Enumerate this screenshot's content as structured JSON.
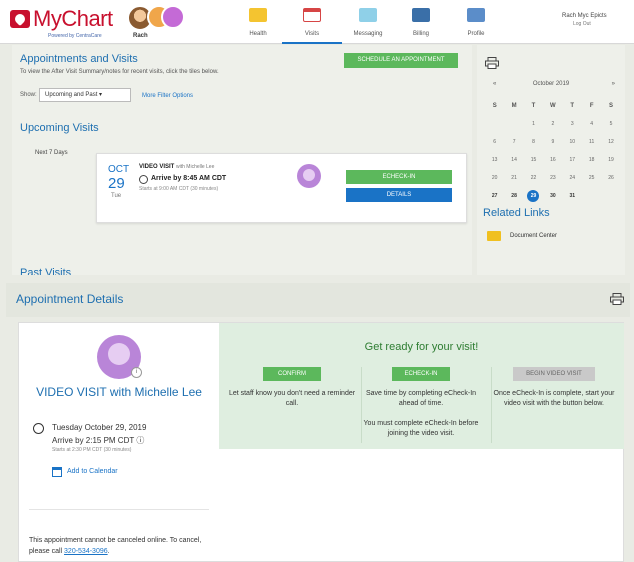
{
  "app": {
    "logo_text": "MyChart",
    "logo_sub": "Powered by CentraCare",
    "avatar_name": "Rach",
    "profile_name": "Rach Myc Epicts",
    "logout": "Log Out"
  },
  "nav": [
    {
      "label": "Health",
      "icon": "health-icon",
      "color": "#f4c430"
    },
    {
      "label": "Visits",
      "icon": "calendar-icon",
      "color": "#d64545"
    },
    {
      "label": "Messaging",
      "icon": "envelope-icon",
      "color": "#8fd0e8"
    },
    {
      "label": "Billing",
      "icon": "card-icon",
      "color": "#3a6fa8"
    },
    {
      "label": "Profile",
      "icon": "profile-icon",
      "color": "#5b8dc9"
    }
  ],
  "appointments": {
    "title": "Appointments and Visits",
    "description": "To view the After Visit Summary/notes for recent visits, click the tiles below.",
    "schedule_button": "SCHEDULE AN APPOINTMENT",
    "show_label": "Show:",
    "show_value": "Upcoming and Past ▾",
    "filter_link": "More Filter Options",
    "upcoming_title": "Upcoming Visits",
    "next_days": "Next 7 Days",
    "past_title": "Past Visits"
  },
  "visit_card": {
    "month": "OCT",
    "day": "29",
    "dow": "Tue",
    "title": "VIDEO VISIT",
    "with": "with Michelle Lee",
    "arrive": "Arrive by 8:45 AM CDT",
    "starts": "Starts at 9:00 AM CDT (30 minutes)",
    "echeck_button": "ECHECK-IN",
    "details_button": "DETAILS"
  },
  "calendar": {
    "prev": "«",
    "month": "October 2019",
    "next": "»",
    "headers": [
      "S",
      "M",
      "T",
      "W",
      "T",
      "F",
      "S"
    ],
    "weeks": [
      [
        "",
        "",
        "1",
        "2",
        "3",
        "4",
        "5"
      ],
      [
        "6",
        "7",
        "8",
        "9",
        "10",
        "11",
        "12"
      ],
      [
        "13",
        "14",
        "15",
        "16",
        "17",
        "18",
        "19"
      ],
      [
        "20",
        "21",
        "22",
        "23",
        "24",
        "25",
        "26"
      ],
      [
        "27",
        "28",
        "29",
        "30",
        "31",
        "",
        ""
      ]
    ],
    "today": "29"
  },
  "related": {
    "title": "Related Links",
    "link": "Document Center"
  },
  "details": {
    "title": "Appointment Details",
    "visit_title": "VIDEO VISIT with Michelle Lee",
    "date": "Tuesday October 29, 2019",
    "arrive": "Arrive by 2:15 PM CDT ⓘ",
    "starts": "Starts at 2:30 PM CDT (30 minutes)",
    "add_calendar": "Add to Calendar",
    "cancel_text": "This appointment cannot be canceled online. To cancel, please call ",
    "cancel_phone": "320-534-3096",
    "cancel_end": ".",
    "ready_title": "Get ready for your visit!",
    "steps": [
      {
        "button": "CONFIRM",
        "text": "Let staff know you don't need a reminder call.",
        "color": "#5cb85c"
      },
      {
        "button": "ECHECK-IN",
        "text": "Save time by completing eCheck-In ahead of time.\n\nYou must complete eCheck-In before joining the video visit.",
        "color": "#5cb85c"
      },
      {
        "button": "BEGIN VIDEO VISIT",
        "text": "Once eCheck-In is complete, start your video visit with the button below.",
        "color": "#c9c9c9"
      }
    ]
  }
}
